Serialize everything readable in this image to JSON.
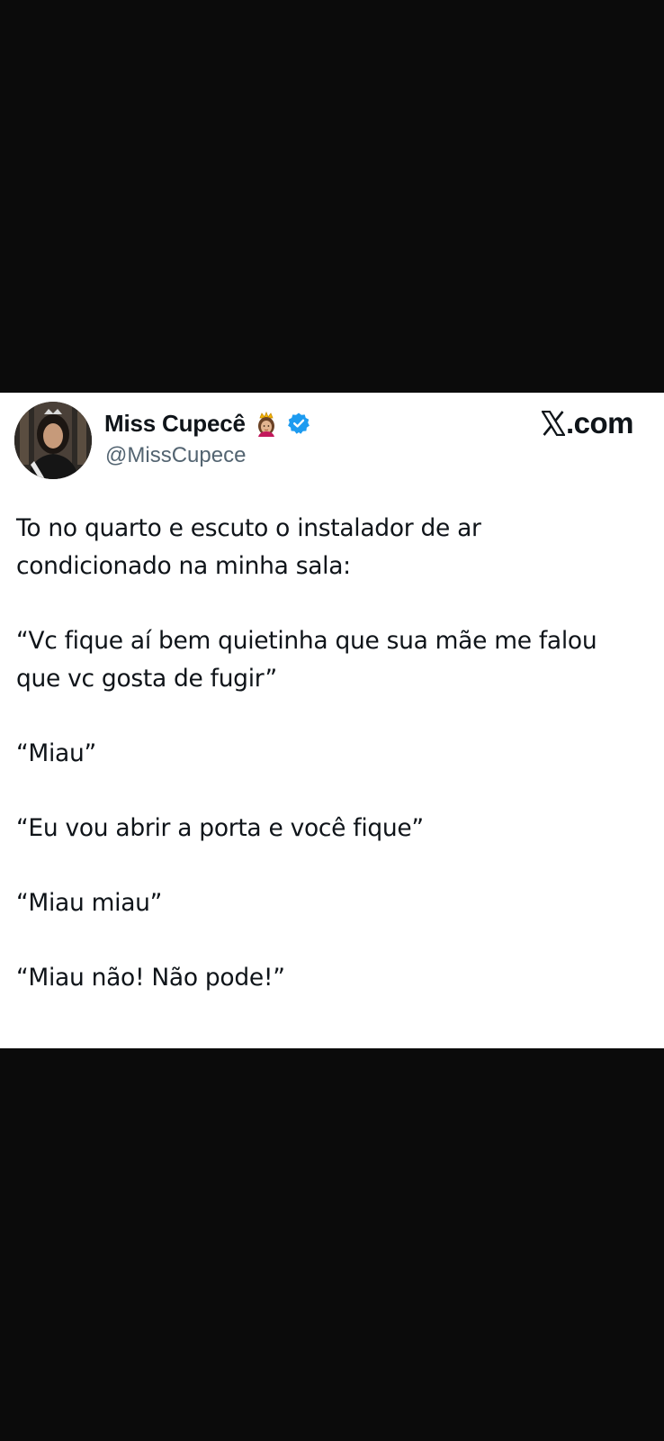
{
  "tweet": {
    "author": {
      "display_name": "Miss Cupecê",
      "handle": "@MissCupece",
      "name_emoji": "princess-emoji",
      "verified_badge": "verified-icon"
    },
    "site": {
      "logo": "x-logo-icon",
      "label": ".com"
    },
    "paragraphs": [
      "To no quarto e escuto o instalador de ar\ncondicionado na minha sala:",
      "“Vc fique aí bem quietinha que sua mãe me falou\nque vc gosta de fugir”",
      "“Miau”",
      "“Eu vou abrir a porta e você fique”",
      "“Miau miau”",
      "“Miau não! Não pode!”"
    ]
  },
  "colors": {
    "background_band": "#0b0b0b",
    "card": "#ffffff",
    "text_primary": "#0f1419",
    "text_secondary": "#536471",
    "verified_blue": "#1d9bf0"
  }
}
